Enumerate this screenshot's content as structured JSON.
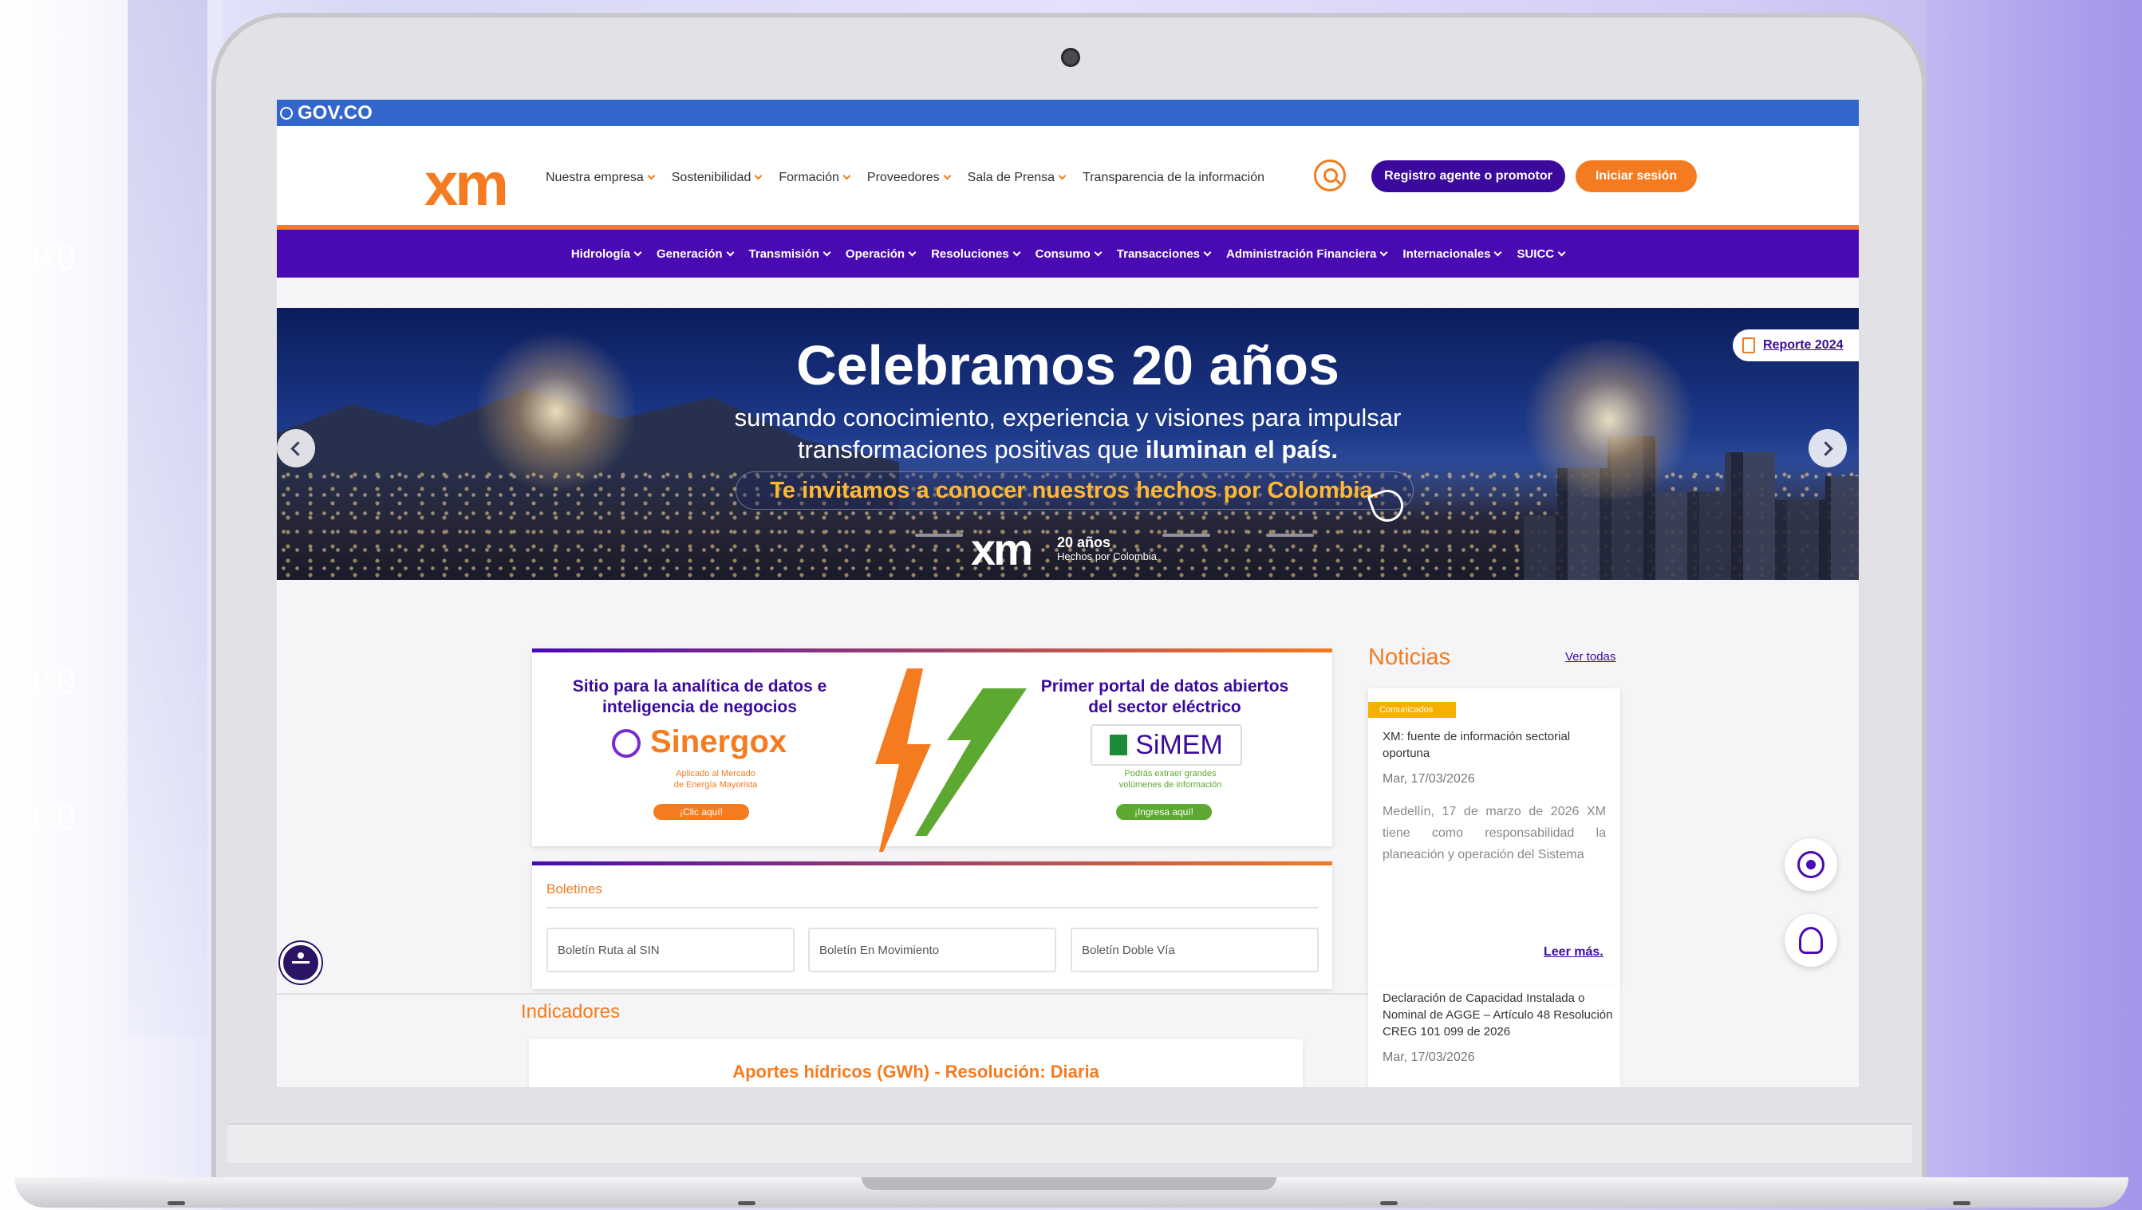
{
  "gov_bar": {
    "label": "GOV.CO"
  },
  "header": {
    "logo": "xm",
    "nav": [
      {
        "label": "Nuestra empresa",
        "has_menu": true
      },
      {
        "label": "Sostenibilidad",
        "has_menu": true
      },
      {
        "label": "Formación",
        "has_menu": true
      },
      {
        "label": "Proveedores",
        "has_menu": true
      },
      {
        "label": "Sala de Prensa",
        "has_menu": true
      },
      {
        "label": "Transparencia de la información",
        "has_menu": false
      }
    ],
    "register_label": "Registro agente o promotor",
    "login_label": "Iniciar sesión"
  },
  "sub_nav": [
    "Hidrología",
    "Generación",
    "Transmisión",
    "Operación",
    "Resoluciones",
    "Consumo",
    "Transacciones",
    "Administración Financiera",
    "Internacionales",
    "SUICC"
  ],
  "banner": {
    "title": "Celebramos 20 años",
    "subtitle_line1": "sumando conocimiento, experiencia y visiones para impulsar",
    "subtitle_line2_pre": "transformaciones positivas que ",
    "subtitle_line2_bold": "iluminan el país.",
    "cta": "Te invitamos a conocer nuestros hechos por Colombia.",
    "logo": "xm",
    "logo_years": "20 años",
    "logo_tagline": "Hechos por Colombia",
    "report_label": "Reporte 2024"
  },
  "analytics": {
    "left_title": "Sitio para la analítica de datos e inteligencia de negocios",
    "left_logo": "Sinergox",
    "left_tagline_1": "Aplicado al Mercado",
    "left_tagline_2": "de Energía Mayorista",
    "left_cta": "¡Clic aquí!",
    "right_title": "Primer portal de datos abiertos del sector eléctrico",
    "right_logo": "SiMEM",
    "right_tagline_1": "Podrás extraer grandes",
    "right_tagline_2": "volúmenes de información",
    "right_cta": "¡Ingresa aquí!"
  },
  "boletines": {
    "title": "Boletines",
    "items": [
      "Boletín Ruta al SIN",
      "Boletín En Movimiento",
      "Boletín Doble Vía"
    ]
  },
  "indicadores": {
    "title": "Indicadores",
    "card_title": "Aportes hídricos (GWh) - Resolución: Diaria"
  },
  "news": {
    "title": "Noticias",
    "see_all": "Ver todas",
    "items": [
      {
        "badge": "Comunicados",
        "headline": "XM: fuente de información sectorial oportuna",
        "date": "Mar, 17/03/2026",
        "body": "Medellín, 17 de marzo de 2026 XM tiene como responsabilidad la planeación y operación del Sistema",
        "more": "Leer más."
      },
      {
        "headline": "Declaración de Capacidad Instalada o Nominal de AGGE – Artículo 48 Resolución CREG 101 099 de 2026",
        "date": "Mar, 17/03/2026"
      }
    ]
  },
  "colors": {
    "brand_orange": "#f47b20",
    "brand_purple": "#4a0ab3",
    "gov_blue": "#3366cc"
  }
}
